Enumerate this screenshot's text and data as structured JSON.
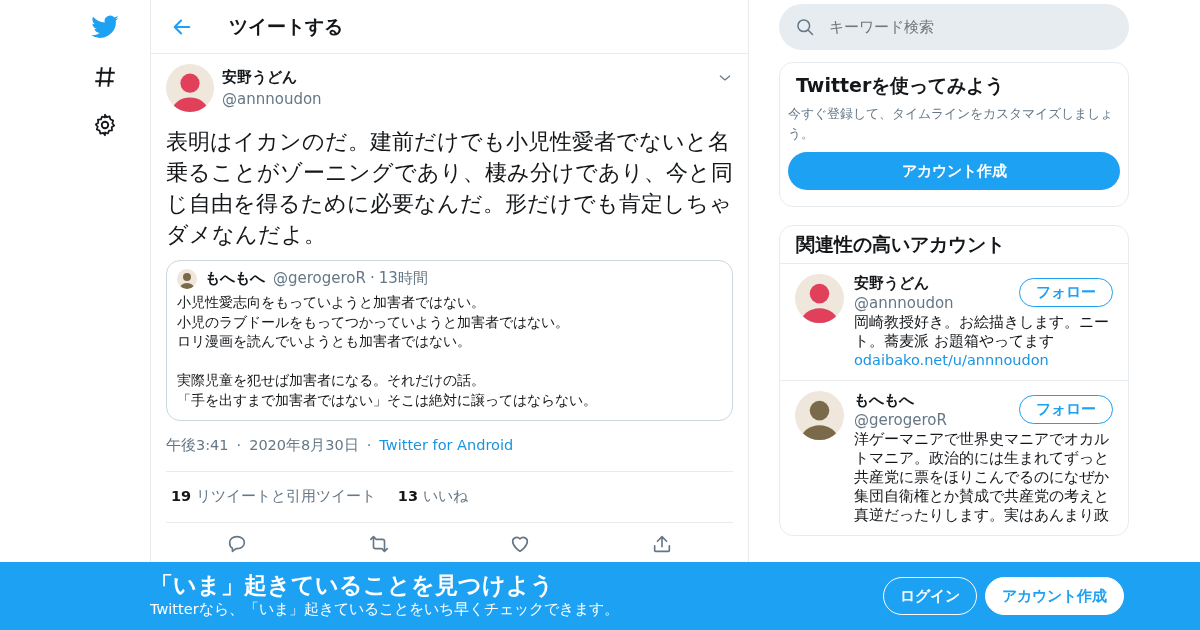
{
  "header": {
    "title": "ツイートする"
  },
  "tweet": {
    "name": "安野うどん",
    "handle": "@annnoudon",
    "text": "表明はイカンのだ。建前だけでも小児性愛者でないと名乗ることがゾーニングであり、棲み分けであり、今と同じ自由を得るために必要なんだ。形だけでも肯定しちゃダメなんだよ。",
    "quote": {
      "name": "もへもへ",
      "handle": "@gerogeroR",
      "separator": "·",
      "time": "13時間",
      "paragraphs": [
        [
          "小児性愛志向をもっていようと加害者ではない。",
          "小児のラブドールをもってつかっていようと加害者ではない。",
          "ロリ漫画を読んでいようとも加害者ではない。"
        ],
        [
          "実際児童を犯せば加害者になる。それだけの話。",
          "「手を出すまで加害者ではない」そこは絶対に譲ってはならない。"
        ]
      ]
    },
    "meta": [
      {
        "kind": "text",
        "text": "午後3:41"
      },
      {
        "kind": "text",
        "text": "2020年8月30日"
      },
      {
        "kind": "link",
        "text": "Twitter for Android"
      }
    ],
    "stats": [
      {
        "count": "19",
        "label": "リツイートと引用ツイート"
      },
      {
        "count": "13",
        "label": "いいね"
      }
    ]
  },
  "search": {
    "placeholder": "キーワード検索"
  },
  "signup_card": {
    "title": "Twitterを使ってみよう",
    "text": "今すぐ登録して、タイムラインをカスタマイズしましょう。",
    "button": "アカウント作成"
  },
  "related": {
    "title": "関連性の高いアカウント",
    "accounts": [
      {
        "name": "安野うどん",
        "handle": "@annnoudon",
        "bio": "岡崎教授好き。お絵描きします。ニート。蕎麦派 お題箱やってます",
        "link": "odaibako.net/u/annnoudon",
        "button": "フォロー",
        "color": "#e0405a"
      },
      {
        "name": "もへもへ",
        "handle": "@gerogeroR",
        "bio": "洋ゲーマニアで世界史マニアでオカルトマニア。政治的には生まれてずっと共産党に票をほりこんでるのになぜか集団自衛権とか賛成で共産党の考えと真逆だったりします。実はあんまり政",
        "button": "フォロー",
        "color": "#7a6a4a"
      }
    ]
  },
  "banner": {
    "title": "「いま」起きていることを見つけよう",
    "subtitle": "Twitterなら、「いま」起きていることをいち早くチェックできます。",
    "buttons": [
      {
        "kind": "outline",
        "label": "ログイン"
      },
      {
        "kind": "solid",
        "label": "アカウント作成"
      }
    ]
  }
}
